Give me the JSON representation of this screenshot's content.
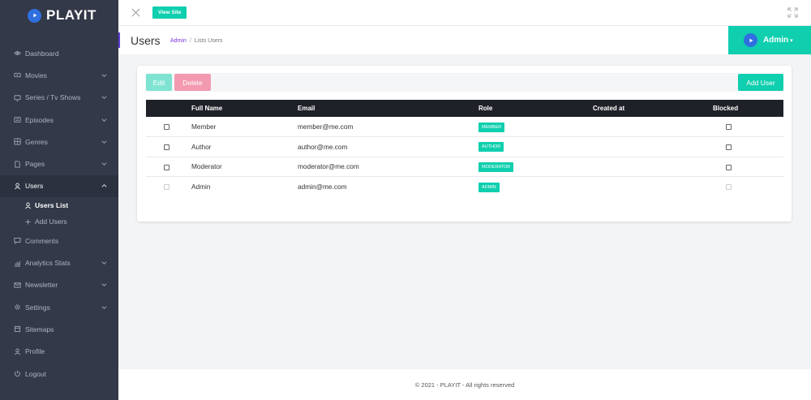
{
  "app": {
    "logo_text": "PLAYIT"
  },
  "sidebar": {
    "items": [
      {
        "key": "dashboard",
        "label": "Dashboard",
        "icon": "eye-icon",
        "has_chevron": false
      },
      {
        "key": "movies",
        "label": "Movies",
        "icon": "film-icon",
        "has_chevron": true
      },
      {
        "key": "series",
        "label": "Series / Tv Shows",
        "icon": "tv-icon",
        "has_chevron": true
      },
      {
        "key": "episodes",
        "label": "Episodes",
        "icon": "episodes-icon",
        "has_chevron": true
      },
      {
        "key": "genres",
        "label": "Genres",
        "icon": "genres-icon",
        "has_chevron": true
      },
      {
        "key": "pages",
        "label": "Pages",
        "icon": "pages-icon",
        "has_chevron": true
      },
      {
        "key": "users",
        "label": "Users",
        "icon": "user-icon",
        "has_chevron": true,
        "active": true
      },
      {
        "key": "comments",
        "label": "Comments",
        "icon": "comment-icon",
        "has_chevron": false
      },
      {
        "key": "analytics",
        "label": "Analytics Stats",
        "icon": "chart-icon",
        "has_chevron": true
      },
      {
        "key": "newsletter",
        "label": "Newsletter",
        "icon": "mail-icon",
        "has_chevron": true
      },
      {
        "key": "settings",
        "label": "Settings",
        "icon": "gear-icon",
        "has_chevron": true
      },
      {
        "key": "sitemaps",
        "label": "Sitemaps",
        "icon": "sitemap-icon",
        "has_chevron": false
      },
      {
        "key": "profile",
        "label": "Profile",
        "icon": "profile-icon",
        "has_chevron": false
      },
      {
        "key": "logout",
        "label": "Logout",
        "icon": "power-icon",
        "has_chevron": false
      }
    ],
    "users_submenu": [
      {
        "label": "Users List",
        "icon": "user-icon",
        "active": true
      },
      {
        "label": "Add Users",
        "icon": "plus-icon",
        "active": false
      }
    ]
  },
  "topbar": {
    "view_site_label": "View Site"
  },
  "header": {
    "title": "Users",
    "breadcrumb_link": "Admin",
    "breadcrumb_separator": "/",
    "breadcrumb_current": "Lists Users",
    "admin_label": "Admin"
  },
  "toolbar": {
    "edit_label": "Edit",
    "delete_label": "Delete",
    "add_label": "Add User"
  },
  "table": {
    "headers": [
      "",
      "Full Name",
      "Email",
      "Role",
      "Created at",
      "Blocked"
    ],
    "rows": [
      {
        "name": "Member",
        "email": "member@me.com",
        "role": "MEMBER",
        "created": "",
        "disabled": false
      },
      {
        "name": "Author",
        "email": "author@me.com",
        "role": "AUTHOR",
        "created": "",
        "disabled": false
      },
      {
        "name": "Moderator",
        "email": "moderator@me.com",
        "role": "MODERATOR",
        "created": "",
        "disabled": false
      },
      {
        "name": "Admin",
        "email": "admin@me.com",
        "role": "ADMIN",
        "created": "",
        "disabled": true
      }
    ]
  },
  "footer": {
    "text": "© 2021 - PLAYIT - All rights reserved"
  },
  "colors": {
    "accent": "#0fcfae",
    "sidebar_bg": "#333948",
    "delete": "#f39ab0",
    "brand_blue": "#2f6fe0",
    "purple": "#5b3fd6"
  }
}
